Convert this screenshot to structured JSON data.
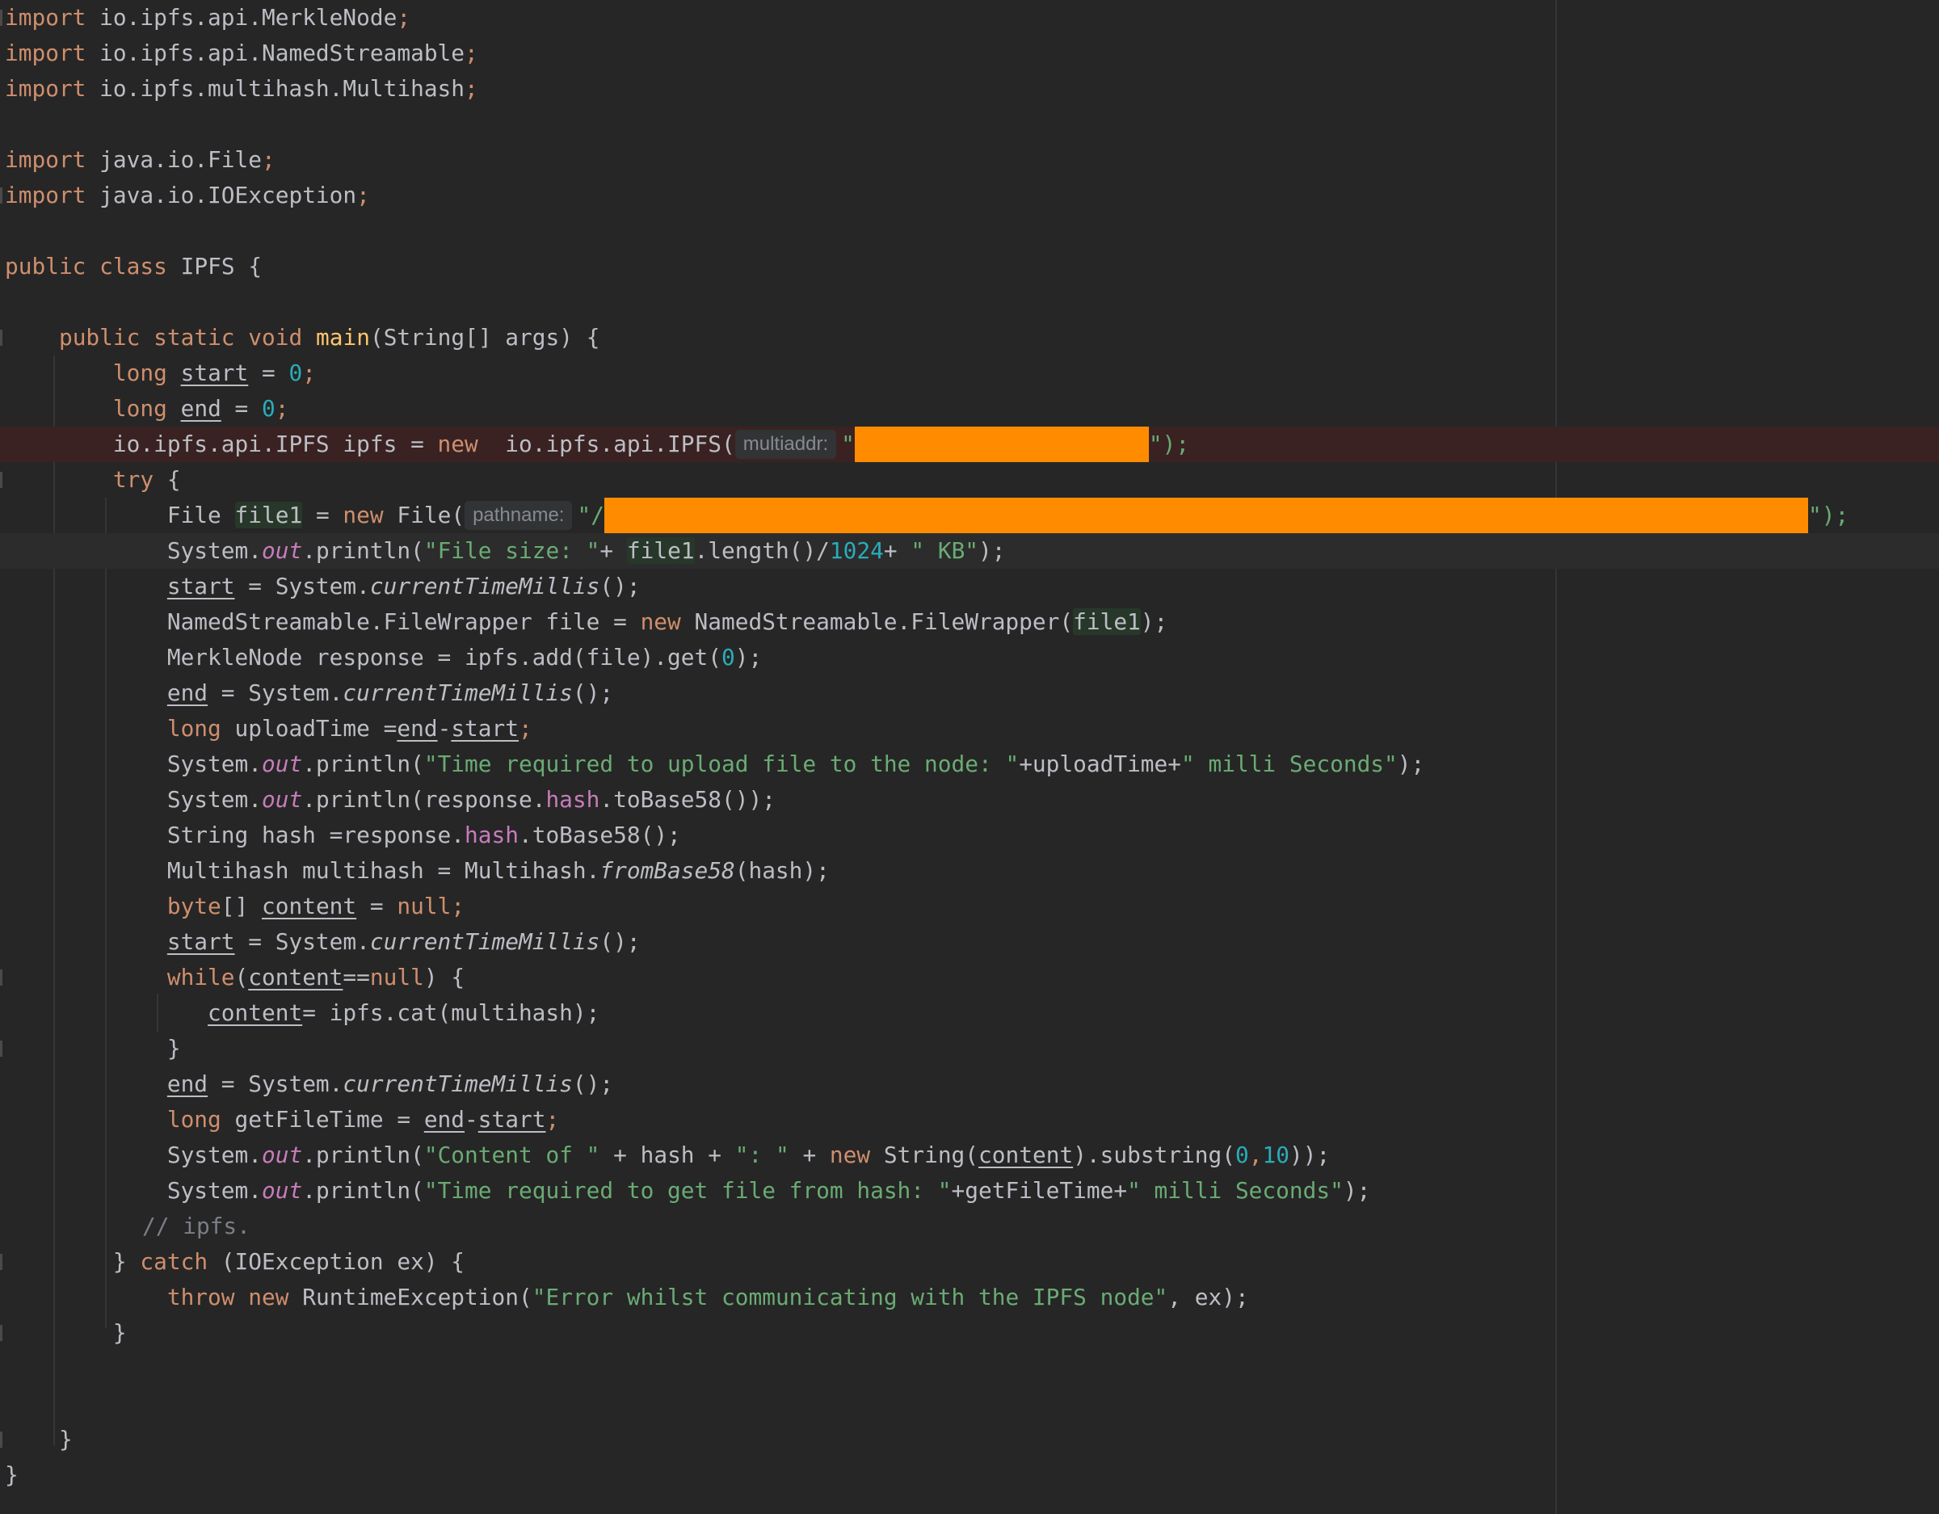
{
  "imports": {
    "line1": {
      "keyword": "import",
      "path": "io.ipfs.api.MerkleNode"
    },
    "line2": {
      "keyword": "import",
      "path": "io.ipfs.api.NamedStreamable"
    },
    "line3": {
      "keyword": "import",
      "path": "io.ipfs.multihash.Multihash"
    },
    "line4": {
      "keyword": "import",
      "path": "java.io.File"
    },
    "line5": {
      "keyword": "import",
      "path": "java.io.IOException"
    }
  },
  "code": {
    "class_decl": {
      "kw1": "public",
      "kw2": "class",
      "name": "IPFS",
      "brace": "{"
    },
    "main_decl": {
      "kw1": "public",
      "kw2": "static",
      "kw3": "void",
      "name": "main",
      "params": "(String[] args) {"
    },
    "start_decl": {
      "type": "long",
      "name": "start",
      "eq": " = ",
      "value": "0"
    },
    "end_decl": {
      "type": "long",
      "name": "end",
      "eq": " = ",
      "value": "0"
    },
    "ipfs_line": {
      "decl": "io.ipfs.api.IPFS ipfs = ",
      "kw": "new",
      "ctor": "  io.ipfs.api.IPFS(",
      "hint": "multiaddr:",
      "quote_open": "\"",
      "close": "\");"
    },
    "try_line": {
      "kw": "try",
      "brace": " {"
    },
    "file_line": {
      "type": "File ",
      "var": "file1",
      "eq": " = ",
      "kw": "new",
      "ctor": " File(",
      "hint": "pathname:",
      "quote_open": "\"/",
      "close": "\");"
    },
    "size_line": {
      "pre": "System.",
      "out": "out",
      "call": ".println(",
      "str": "\"File size: \"",
      "plus": "+ ",
      "var": "file1",
      "rest": ".length()/",
      "num": "1024",
      "plus2": "+ ",
      "str2": "\" KB\"",
      "end": ");"
    },
    "start_assign1": {
      "var": "start",
      "mid": " = System.",
      "method": "currentTimeMillis",
      "end": "();"
    },
    "wrapper_line": {
      "pre": "NamedStreamable.FileWrapper file = ",
      "kw": "new",
      "mid": " NamedStreamable.FileWrapper(",
      "var": "file1",
      "end": ");"
    },
    "merkle_line": {
      "pre": "MerkleNode response = ipfs.add(file).get(",
      "num": "0",
      "end": ");"
    },
    "end_assign1": {
      "var": "end",
      "mid": " = System.",
      "method": "currentTimeMillis",
      "end": "();"
    },
    "upload_line": {
      "type": "long",
      "mid": " uploadTime =",
      "var1": "end",
      "minus": "-",
      "var2": "start",
      "end": ";"
    },
    "upload_print": {
      "pre": "System.",
      "out": "out",
      "call": ".println(",
      "str": "\"Time required to upload file to the node: \"",
      "mid": "+uploadTime+",
      "str2": "\" milli Seconds\"",
      "end": ");"
    },
    "hash_print": {
      "pre": "System.",
      "out": "out",
      "call": ".println(response.",
      "field": "hash",
      "end": ".toBase58());"
    },
    "hash_line": {
      "pre": "String hash =response.",
      "field": "hash",
      "end": ".toBase58();"
    },
    "multihash_line": {
      "pre": "Multihash multihash = Multihash.",
      "method": "fromBase58",
      "end": "(hash);"
    },
    "content_line": {
      "type": "byte",
      "mid": "[] ",
      "var": "content",
      "eq": " = ",
      "kw": "null",
      "end": ";"
    },
    "start_assign2": {
      "var": "start",
      "mid": " = System.",
      "method": "currentTimeMillis",
      "end": "();"
    },
    "while_line": {
      "kw": "while",
      "open": "(",
      "var": "content",
      "op": "==",
      "kw2": "null",
      "end": ") {"
    },
    "cat_line": {
      "var": "content",
      "rest": "= ipfs.cat(multihash);"
    },
    "while_close": {
      "brace": "}"
    },
    "end_assign2": {
      "var": "end",
      "mid": " = System.",
      "method": "currentTimeMillis",
      "end": "();"
    },
    "getfile_line": {
      "type": "long",
      "mid": " getFileTime = ",
      "var1": "end",
      "minus": "-",
      "var2": "start",
      "end": ";"
    },
    "content_print": {
      "pre": "System.",
      "out": "out",
      "call": ".println(",
      "str": "\"Content of \"",
      "mid": " + hash + ",
      "str2": "\": \"",
      "mid2": " + ",
      "kw": "new",
      "mid3": " String(",
      "var": "content",
      "mid4": ").substring(",
      "num1": "0",
      "comma": ",",
      "num2": "10",
      "end": "));"
    },
    "gettime_print": {
      "pre": "System.",
      "out": "out",
      "call": ".println(",
      "str": "\"Time required to get file from hash: \"",
      "mid": "+getFileTime+",
      "str2": "\" milli Seconds\"",
      "end": ");"
    },
    "comment_line": {
      "text": "// ipfs."
    },
    "catch_line": {
      "brace": "} ",
      "kw": "catch",
      "rest": " (IOException ex) {"
    },
    "throw_line": {
      "kw1": "throw",
      "kw2": "new",
      "mid": " RuntimeException(",
      "str": "\"Error whilst communicating with the IPFS node\"",
      "end": ", ex);"
    },
    "catch_close": {
      "brace": "}"
    },
    "main_close": {
      "brace": "}"
    },
    "class_close": {
      "brace": "}"
    }
  },
  "colors": {
    "background": "#262626",
    "keyword": "#cf8e6d",
    "string": "#6aab73",
    "number": "#2aacb8",
    "method_decl": "#ffc66d",
    "static_field": "#c77dbb",
    "redaction": "#ff8c00",
    "error_line": "#3a2222"
  }
}
